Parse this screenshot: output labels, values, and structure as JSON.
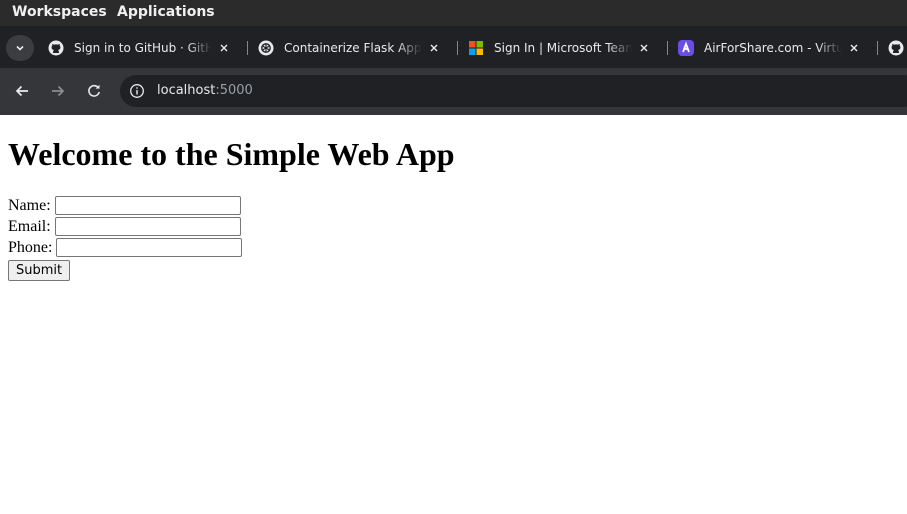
{
  "desktop_bar": {
    "items": [
      "Workspaces",
      "Applications"
    ]
  },
  "browser": {
    "tabs": [
      {
        "title": "Sign in to GitHub · GitHub",
        "icon": "github-icon"
      },
      {
        "title": "Containerize Flask App",
        "icon": "openai-icon"
      },
      {
        "title": "Sign In | Microsoft Teams",
        "icon": "microsoft-icon"
      },
      {
        "title": "AirForShare.com - Virtual Clipboard",
        "icon": "airforshare-icon"
      }
    ],
    "address": {
      "host": "localhost",
      "port": ":5000"
    }
  },
  "page": {
    "heading": "Welcome to the Simple Web App",
    "form": {
      "name_label": "Name:",
      "email_label": "Email:",
      "phone_label": "Phone:",
      "name_value": "",
      "email_value": "",
      "phone_value": "",
      "submit_label": "Submit"
    }
  },
  "colors": {
    "desktop_bar": "#2b2b2b",
    "tab_strip": "#202124",
    "toolbar": "#35363a",
    "omnibox": "#202124",
    "airforshare_accent": "#6b4de6"
  }
}
